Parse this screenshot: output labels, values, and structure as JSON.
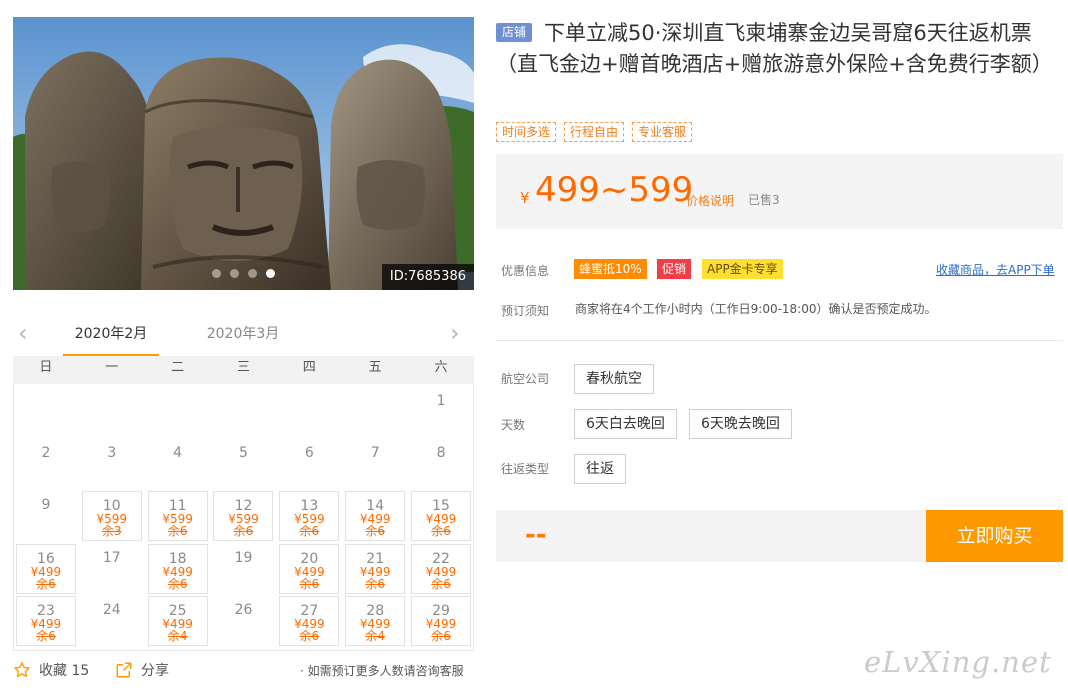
{
  "product": {
    "shop_badge": "店铺",
    "title": "下单立减50·深圳直飞柬埔寨金边吴哥窟6天往返机票（直飞金边+赠首晚酒店+赠旅游意外保险+含免费行李额）",
    "tags": [
      "时间多选",
      "行程自由",
      "专业客服"
    ],
    "image_id": "ID:7685386",
    "image_dots": 4,
    "image_active_dot": 3
  },
  "price": {
    "currency": "¥",
    "range": "499~599",
    "explain_link": "价格说明",
    "sold": "已售3"
  },
  "promos": {
    "label": "优惠信息",
    "items": [
      "蜂蜜抵10%",
      "促销",
      "APP金卡专享"
    ],
    "app_link": "收藏商品，去APP下单"
  },
  "booking": {
    "label": "预订须知",
    "note": "商家将在4个工作小时内（工作日9:00-18:00）确认是否预定成功。"
  },
  "options": {
    "airline_label": "航空公司",
    "airline": [
      "春秋航空"
    ],
    "days_label": "天数",
    "days": [
      "6天白去晚回",
      "6天晚去晚回"
    ],
    "trip_label": "往返类型",
    "trip": [
      "往返"
    ]
  },
  "buy": {
    "selected_price": "--",
    "button": "立即购买"
  },
  "calendar": {
    "prev_icon": "chevron-left-icon",
    "next_icon": "chevron-right-icon",
    "months": [
      "2020年2月",
      "2020年3月"
    ],
    "active_month": 0,
    "weekdays": [
      "日",
      "一",
      "二",
      "三",
      "四",
      "五",
      "六"
    ],
    "first_weekday": 6,
    "days": [
      {
        "d": "1"
      },
      {
        "d": "2"
      },
      {
        "d": "3"
      },
      {
        "d": "4"
      },
      {
        "d": "5"
      },
      {
        "d": "6"
      },
      {
        "d": "7"
      },
      {
        "d": "8"
      },
      {
        "d": "9"
      },
      {
        "d": "10",
        "p": "¥599",
        "r": "余3"
      },
      {
        "d": "11",
        "p": "¥599",
        "r": "余6"
      },
      {
        "d": "12",
        "p": "¥599",
        "r": "余6"
      },
      {
        "d": "13",
        "p": "¥599",
        "r": "余6"
      },
      {
        "d": "14",
        "p": "¥499",
        "r": "余6"
      },
      {
        "d": "15",
        "p": "¥499",
        "r": "余6"
      },
      {
        "d": "16",
        "p": "¥499",
        "r": "余6"
      },
      {
        "d": "17"
      },
      {
        "d": "18",
        "p": "¥499",
        "r": "余6"
      },
      {
        "d": "19"
      },
      {
        "d": "20",
        "p": "¥499",
        "r": "余6"
      },
      {
        "d": "21",
        "p": "¥499",
        "r": "余6"
      },
      {
        "d": "22",
        "p": "¥499",
        "r": "余6"
      },
      {
        "d": "23",
        "p": "¥499",
        "r": "余6"
      },
      {
        "d": "24"
      },
      {
        "d": "25",
        "p": "¥499",
        "r": "余4"
      },
      {
        "d": "26"
      },
      {
        "d": "27",
        "p": "¥499",
        "r": "余6"
      },
      {
        "d": "28",
        "p": "¥499",
        "r": "余4"
      },
      {
        "d": "29",
        "p": "¥499",
        "r": "余6"
      }
    ]
  },
  "footer": {
    "favorite_label": "收藏 15",
    "share_label": "分享",
    "note": "· 如需预订更多人数请咨询客服"
  },
  "watermark": "eLvXing.net",
  "colors": {
    "accent": "#ff9900",
    "price": "#ff6a00",
    "link": "#2c6bd1"
  }
}
